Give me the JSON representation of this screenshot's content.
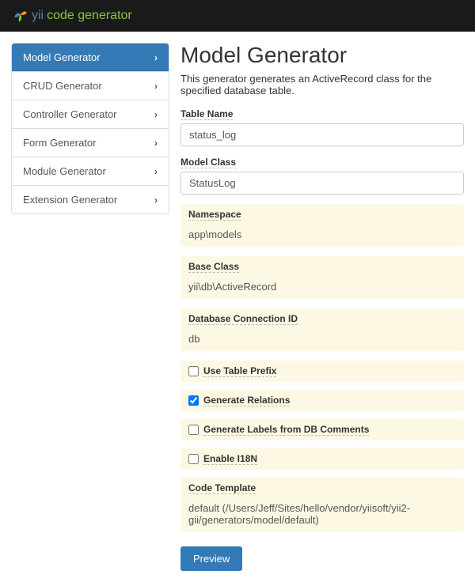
{
  "header": {
    "brand_yii": "yii",
    "brand_code": "code generator"
  },
  "sidebar": {
    "items": [
      {
        "label": "Model Generator",
        "active": true
      },
      {
        "label": "CRUD Generator",
        "active": false
      },
      {
        "label": "Controller Generator",
        "active": false
      },
      {
        "label": "Form Generator",
        "active": false
      },
      {
        "label": "Module Generator",
        "active": false
      },
      {
        "label": "Extension Generator",
        "active": false
      }
    ]
  },
  "main": {
    "title": "Model Generator",
    "description": "This generator generates an ActiveRecord class for the specified database table.",
    "fields": {
      "table_name": {
        "label": "Table Name",
        "value": "status_log"
      },
      "model_class": {
        "label": "Model Class",
        "value": "StatusLog"
      },
      "namespace": {
        "label": "Namespace",
        "value": "app\\models"
      },
      "base_class": {
        "label": "Base Class",
        "value": "yii\\db\\ActiveRecord"
      },
      "db_connection": {
        "label": "Database Connection ID",
        "value": "db"
      },
      "code_template": {
        "label": "Code Template",
        "value": "default (/Users/Jeff/Sites/hello/vendor/yiisoft/yii2-gii/generators/model/default)"
      }
    },
    "checkboxes": {
      "use_table_prefix": {
        "label": "Use Table Prefix",
        "checked": false
      },
      "generate_relations": {
        "label": "Generate Relations",
        "checked": true
      },
      "generate_labels": {
        "label": "Generate Labels from DB Comments",
        "checked": false
      },
      "enable_i18n": {
        "label": "Enable I18N",
        "checked": false
      }
    },
    "preview_button": "Preview"
  }
}
